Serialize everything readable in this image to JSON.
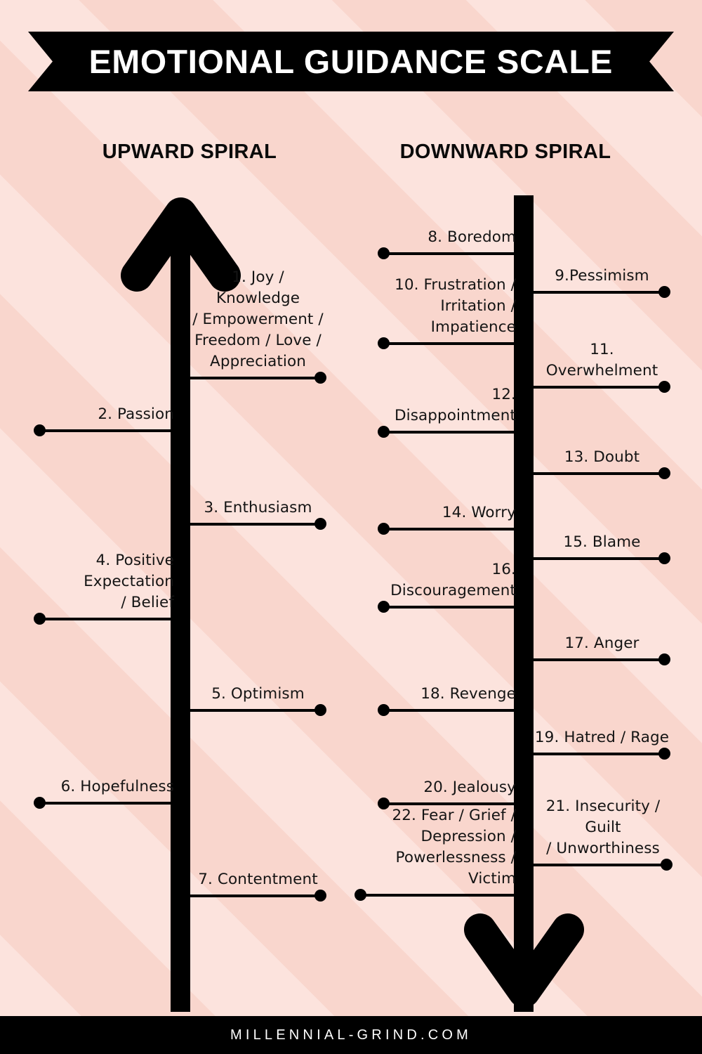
{
  "meta": {
    "title": "EMOTIONAL GUIDANCE SCALE",
    "footer": "MILLENNIAL-GRIND.COM"
  },
  "colors": {
    "background_light": "#fce3dd",
    "background_dark": "#f9d6cd",
    "ink": "#000000",
    "banner_text": "#ffffff"
  },
  "columns": {
    "upward": {
      "header": "UPWARD SPIRAL"
    },
    "downward": {
      "header": "DOWNWARD SPIRAL"
    }
  },
  "upward_items": [
    {
      "n": 1,
      "label": "1.  Joy / Knowledge\n/ Empowerment /\nFreedom / Love /\nAppreciation",
      "side": "right"
    },
    {
      "n": 2,
      "label": "2. Passion",
      "side": "left"
    },
    {
      "n": 3,
      "label": "3. Enthusiasm",
      "side": "right"
    },
    {
      "n": 4,
      "label": "4. Positive Expectation\n/ Belief",
      "side": "left"
    },
    {
      "n": 5,
      "label": "5. Optimism",
      "side": "right"
    },
    {
      "n": 6,
      "label": "6. Hopefulness",
      "side": "left"
    },
    {
      "n": 7,
      "label": "7. Contentment",
      "side": "right"
    }
  ],
  "downward_items": [
    {
      "n": 8,
      "label": "8. Boredom",
      "side": "left"
    },
    {
      "n": 9,
      "label": "9.Pessimism",
      "side": "right"
    },
    {
      "n": 10,
      "label": "10. Frustration /\nIrritation /\nImpatience",
      "side": "left"
    },
    {
      "n": 11,
      "label": "11. Overwhelment",
      "side": "right"
    },
    {
      "n": 12,
      "label": "12. Disappointment",
      "side": "left"
    },
    {
      "n": 13,
      "label": "13. Doubt",
      "side": "right"
    },
    {
      "n": 14,
      "label": "14. Worry",
      "side": "left"
    },
    {
      "n": 15,
      "label": "15. Blame",
      "side": "right"
    },
    {
      "n": 16,
      "label": "16. Discouragement",
      "side": "left"
    },
    {
      "n": 17,
      "label": "17. Anger",
      "side": "right"
    },
    {
      "n": 18,
      "label": "18. Revenge",
      "side": "left"
    },
    {
      "n": 19,
      "label": "19. Hatred / Rage",
      "side": "right"
    },
    {
      "n": 20,
      "label": "20. Jealousy",
      "side": "left"
    },
    {
      "n": 21,
      "label": "21. Insecurity / Guilt\n/ Unworthiness",
      "side": "right"
    },
    {
      "n": 22,
      "label": "22. Fear / Grief /\nDepression /\nPowerlessness / Victim",
      "side": "left"
    }
  ],
  "icons": {
    "up_arrow": "up-arrow-icon",
    "down_arrow": "down-arrow-icon"
  }
}
